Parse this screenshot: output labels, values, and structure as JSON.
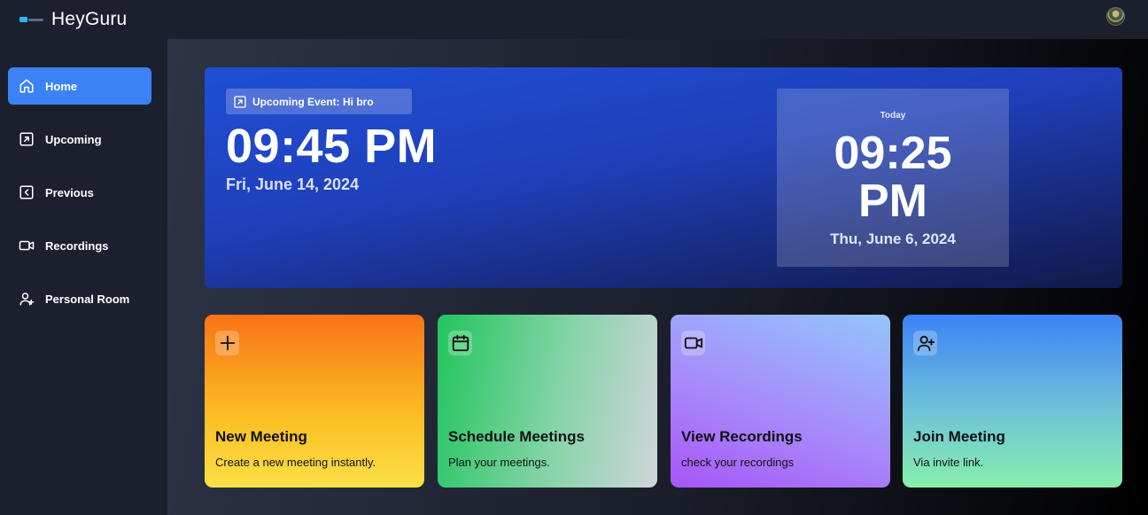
{
  "app": {
    "brand": "HeyGuru"
  },
  "sidebar": {
    "items": [
      {
        "label": "Home",
        "icon": "home-icon"
      },
      {
        "label": "Upcoming",
        "icon": "arrow-up-right-icon"
      },
      {
        "label": "Previous",
        "icon": "chevron-left-icon"
      },
      {
        "label": "Recordings",
        "icon": "video-icon"
      },
      {
        "label": "Personal Room",
        "icon": "user-plus-icon"
      }
    ],
    "active": "Home"
  },
  "hero": {
    "upcoming_label": "Upcoming Event: Hi bro",
    "time": "09:45 PM",
    "date": "Fri, June 14, 2024",
    "today": {
      "label": "Today",
      "time": "09:25 PM",
      "date": "Thu, June 6, 2024"
    }
  },
  "cards": [
    {
      "title": "New Meeting",
      "desc": "Create a new meeting instantly.",
      "icon": "plus-icon"
    },
    {
      "title": "Schedule Meetings",
      "desc": "Plan your meetings.",
      "icon": "calendar-icon"
    },
    {
      "title": "View Recordings",
      "desc": "check your recordings",
      "icon": "video-icon"
    },
    {
      "title": "Join Meeting",
      "desc": "Via invite link.",
      "icon": "user-plus-icon"
    }
  ],
  "colors": {
    "accent": "#3b82f6",
    "background": "#1c1f2e"
  }
}
